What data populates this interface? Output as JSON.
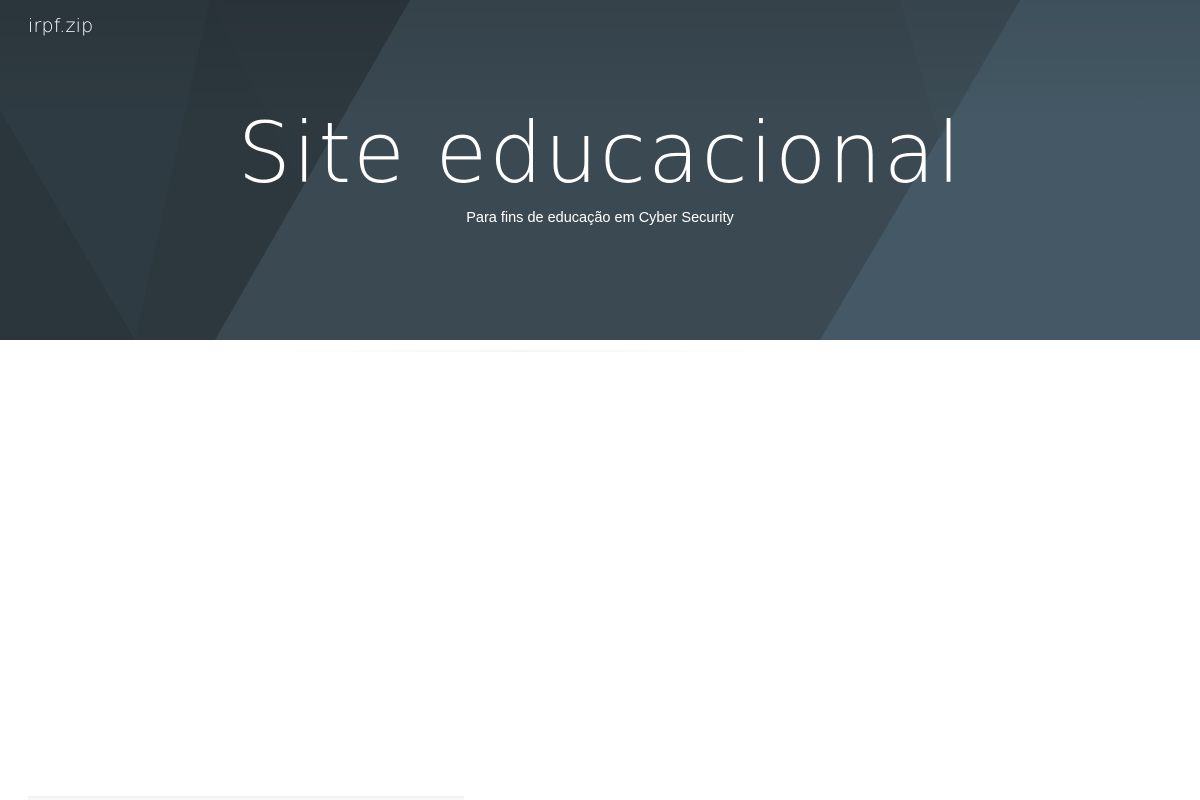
{
  "header": {
    "site_name": "irpf.zip"
  },
  "hero": {
    "title": "Site educacional",
    "subtitle": "Para fins de educação em Cyber Security"
  },
  "colors": {
    "hero_base": "#3d4d57",
    "hero_dark": "#2e3a41",
    "hero_light": "#455a66",
    "text": "#ffffff",
    "page_background": "#ffffff"
  }
}
